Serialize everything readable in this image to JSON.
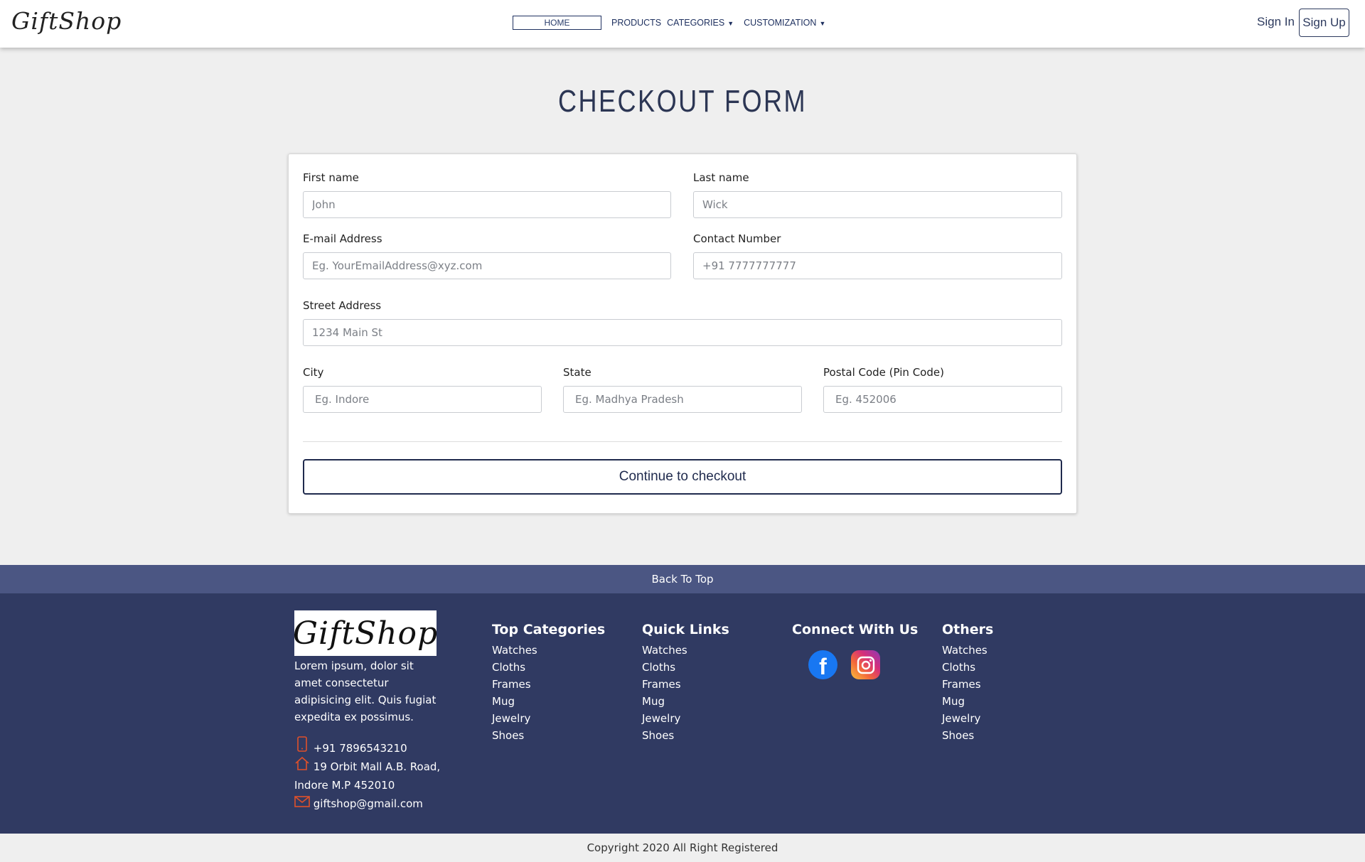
{
  "nav": {
    "brand": "GiftShop",
    "home": "HOME",
    "products": "PRODUCTS",
    "categories": "CATEGORIES",
    "customization": "CUSTOMIZATION",
    "sign_in": "Sign In",
    "sign_up": "Sign Up"
  },
  "page": {
    "title": "CHECKOUT FORM"
  },
  "form": {
    "first_name": {
      "label": "First name",
      "placeholder": "John"
    },
    "last_name": {
      "label": "Last name",
      "placeholder": "Wick"
    },
    "email": {
      "label": "E-mail Address",
      "placeholder": "Eg. YourEmailAddress@xyz.com"
    },
    "contact": {
      "label": "Contact Number",
      "placeholder": "+91 7777777777"
    },
    "street": {
      "label": "Street Address",
      "placeholder": "1234 Main St"
    },
    "city": {
      "label": "City",
      "placeholder": "Eg. Indore"
    },
    "state": {
      "label": "State",
      "placeholder": "Eg. Madhya Pradesh"
    },
    "postal": {
      "label": "Postal Code (Pin Code)",
      "placeholder": "Eg. 452006"
    },
    "submit": "Continue to checkout"
  },
  "footer": {
    "back_to_top": "Back To Top",
    "logo": "GiftShop",
    "about": "Lorem ipsum, dolor sit amet consectetur adipisicing elit. Quis fugiat expedita ex possimus.",
    "phone": "+91 7896543210",
    "address_line1": "19 Orbit Mall A.B. Road,",
    "address_line2": "Indore M.P 452010",
    "email": "giftshop@gmail.com",
    "top_categories": {
      "title": "Top Categories",
      "items": [
        "Watches",
        "Cloths",
        "Frames",
        "Mug",
        "Jewelry",
        "Shoes"
      ]
    },
    "quick_links": {
      "title": "Quick Links",
      "items": [
        "Watches",
        "Cloths",
        "Frames",
        "Mug",
        "Jewelry",
        "Shoes"
      ]
    },
    "connect": {
      "title": "Connect With Us",
      "facebook_glyph": "f"
    },
    "others": {
      "title": "Others",
      "items": [
        "Watches",
        "Cloths",
        "Frames",
        "Mug",
        "Jewelry",
        "Shoes"
      ]
    },
    "copyright": "Copyright 2020 All Right Registered"
  },
  "colors": {
    "navy": "#303a62",
    "back_to_top_bar": "#4b5683",
    "contact_icon": "#e0502a",
    "facebook": "#1877f2"
  },
  "icons": [
    "phone-icon",
    "home-icon",
    "mail-icon",
    "facebook-icon",
    "instagram-icon",
    "caret-down-icon"
  ]
}
